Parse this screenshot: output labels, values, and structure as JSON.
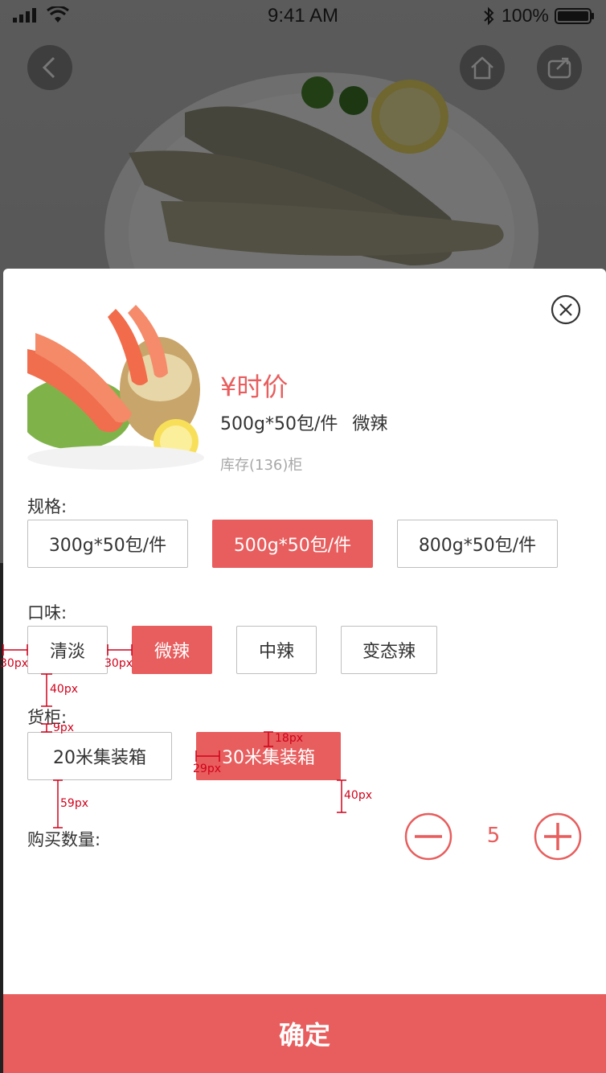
{
  "status_bar": {
    "time": "9:41 AM",
    "battery_percent": "100%"
  },
  "colors": {
    "accent": "#e85d5d",
    "annotation": "#d0021b",
    "border": "#bfbfbf",
    "text": "#333333",
    "muted": "#a8a8a8"
  },
  "background_page": {
    "nav_icons": [
      "back-icon",
      "home-icon",
      "share-icon"
    ]
  },
  "product": {
    "price": "¥时价",
    "selected_spec": "500g*50包/件",
    "selected_flavor": "微辣",
    "stock": "库存(136)柜"
  },
  "spec_group": {
    "label": "规格:",
    "options": [
      "300g*50包/件",
      "500g*50包/件",
      "800g*50包/件"
    ],
    "selected_index": 1
  },
  "flavor_group": {
    "label": "口味:",
    "options": [
      "清淡",
      "微辣",
      "中辣",
      "变态辣"
    ],
    "selected_index": 1
  },
  "cabinet_group": {
    "label": "货柜:",
    "options": [
      "20米集装箱",
      "30米集装箱"
    ],
    "selected_index": 1
  },
  "quantity": {
    "label": "购买数量:",
    "value": "5"
  },
  "confirm_label": "确定",
  "annotations": {
    "a1": "30px",
    "a2": "30px",
    "a3": "40px",
    "a4": "9px",
    "a5": "18px",
    "a6": "29px",
    "a7": "59px",
    "a8": "40px"
  }
}
